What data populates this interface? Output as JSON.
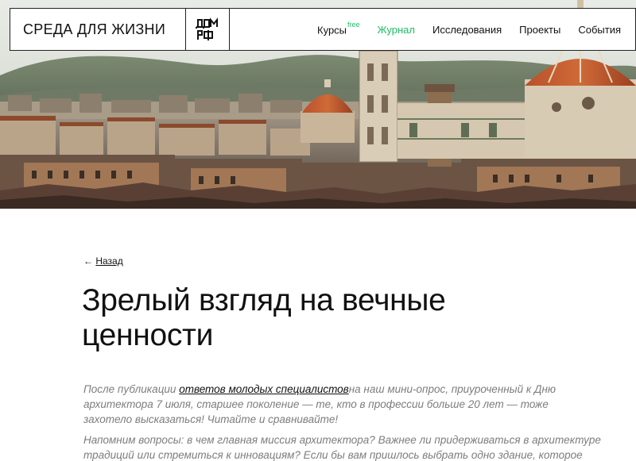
{
  "header": {
    "brand": "СРЕДА ДЛЯ ЖИЗНИ",
    "logo_text_top": "ДОМ",
    "logo_text_bottom": "РФ",
    "nav": [
      {
        "label": "Курсы",
        "badge": "free",
        "active": false
      },
      {
        "label": "Журнал",
        "active": true
      },
      {
        "label": "Исследования",
        "active": false
      },
      {
        "label": "Проекты",
        "active": false
      },
      {
        "label": "События",
        "active": false
      }
    ]
  },
  "hero": {
    "image": "florence-cityscape"
  },
  "article": {
    "back_arrow": "←",
    "back_label": "Назад",
    "title": "Зрелый взгляд на вечные ценности",
    "lead_before": "После публикации ",
    "lead_link": "ответов молодых специалистов",
    "lead_after": "на наш мини-опрос, приуроченный к Дню архитектора 7 июля, старшее поколение — те, кто в профессии больше 20 лет — тоже захотело высказаться! Читайте и сравнивайте!",
    "para2": "Напомним вопросы: в чем главная миссия архитектора? Важнее ли придерживаться в архитектуре традиций или стремиться к инновациям? Если бы вам пришлось выбрать одно здание, которое"
  },
  "colors": {
    "accent": "#1ec063",
    "text": "#111111",
    "muted": "#7d7d7d"
  }
}
